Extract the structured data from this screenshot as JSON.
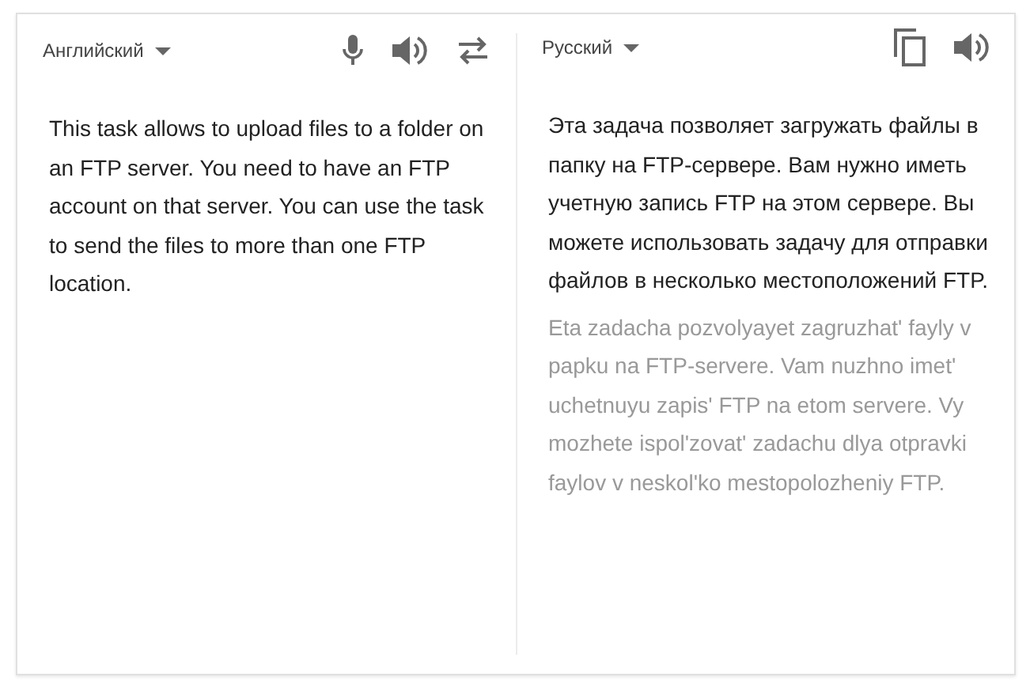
{
  "source": {
    "language": "Английский",
    "text": "This task allows to upload files to a folder on an FTP server. You need to have an FTP account on that server. You can use the task to send the files to more than one FTP location."
  },
  "target": {
    "language": "Русский",
    "text": "Эта задача позволяет загружать файлы в папку на FTP-сервере. Вам нужно иметь учетную запись FTP на этом сервере. Вы можете использовать задачу для отправки файлов в несколько местоположений FTP.",
    "transliteration": "Eta zadacha pozvolyayet zagruzhat' fayly v papku na FTP-servere. Vam nuzhno imet' uchetnuyu zapis' FTP na etom servere. Vy mozhete ispol'zovat' zadachu dlya otpravki faylov v neskol'ko mestopolozheniy FTP."
  }
}
